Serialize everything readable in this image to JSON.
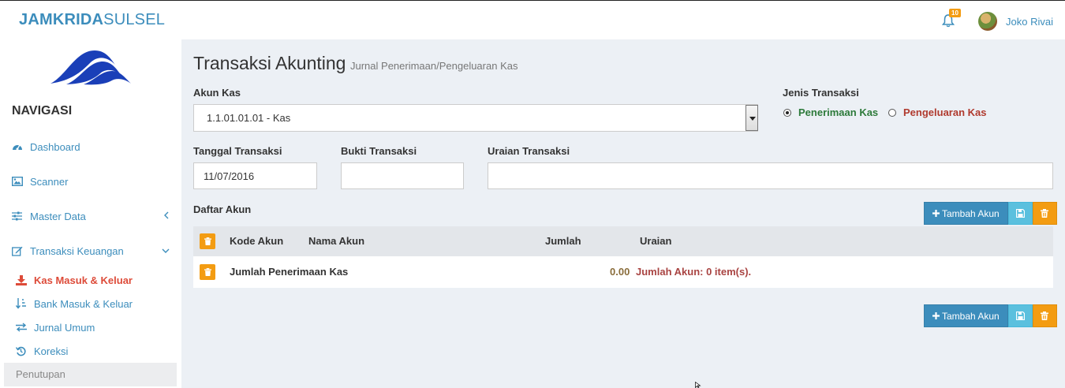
{
  "header": {
    "brand_bold": "JAMKRIDA",
    "brand_rest": "SULSEL",
    "notification_count": "10",
    "user_name": "Joko Rivai"
  },
  "sidebar": {
    "title": "NAVIGASI",
    "items": [
      {
        "label": "Dashboard",
        "icon": "dashboard-icon"
      },
      {
        "label": "Scanner",
        "icon": "image-icon"
      },
      {
        "label": "Master Data",
        "icon": "sliders-icon"
      },
      {
        "label": "Transaksi Keuangan",
        "icon": "edit-icon"
      }
    ],
    "sub_items": [
      {
        "label": "Kas Masuk & Keluar",
        "icon": "download-icon",
        "active": true
      },
      {
        "label": "Bank Masuk & Keluar",
        "icon": "sort-icon"
      },
      {
        "label": "Jurnal Umum",
        "icon": "exchange-icon"
      },
      {
        "label": "Koreksi",
        "icon": "history-icon"
      }
    ],
    "penutupan": "Penutupan"
  },
  "page": {
    "title": "Transaksi Akunting",
    "subtitle": "Jurnal Penerimaan/Pengeluaran Kas"
  },
  "form": {
    "akun_kas_label": "Akun Kas",
    "akun_kas_value": "1.1.01.01.01 - Kas",
    "jenis_label": "Jenis Transaksi",
    "radio_penerimaan": "Penerimaan Kas",
    "radio_pengeluaran": "Pengeluaran Kas",
    "tanggal_label": "Tanggal Transaksi",
    "tanggal_value": "11/07/2016",
    "bukti_label": "Bukti Transaksi",
    "bukti_value": "",
    "uraian_label": "Uraian Transaksi",
    "uraian_value": ""
  },
  "daftar": {
    "title": "Daftar Akun",
    "add_button": "Tambah Akun",
    "columns": [
      "Kode Akun",
      "Nama Akun",
      "Jumlah",
      "Uraian"
    ],
    "summary_label": "Jumlah Penerimaan Kas",
    "summary_amount": "0.00",
    "summary_items": "Jumlah Akun: 0 item(s)."
  },
  "colors": {
    "primary": "#3c8dbc",
    "warning": "#f39c12",
    "info": "#5bc0de",
    "active_nav": "#dd4b39"
  }
}
